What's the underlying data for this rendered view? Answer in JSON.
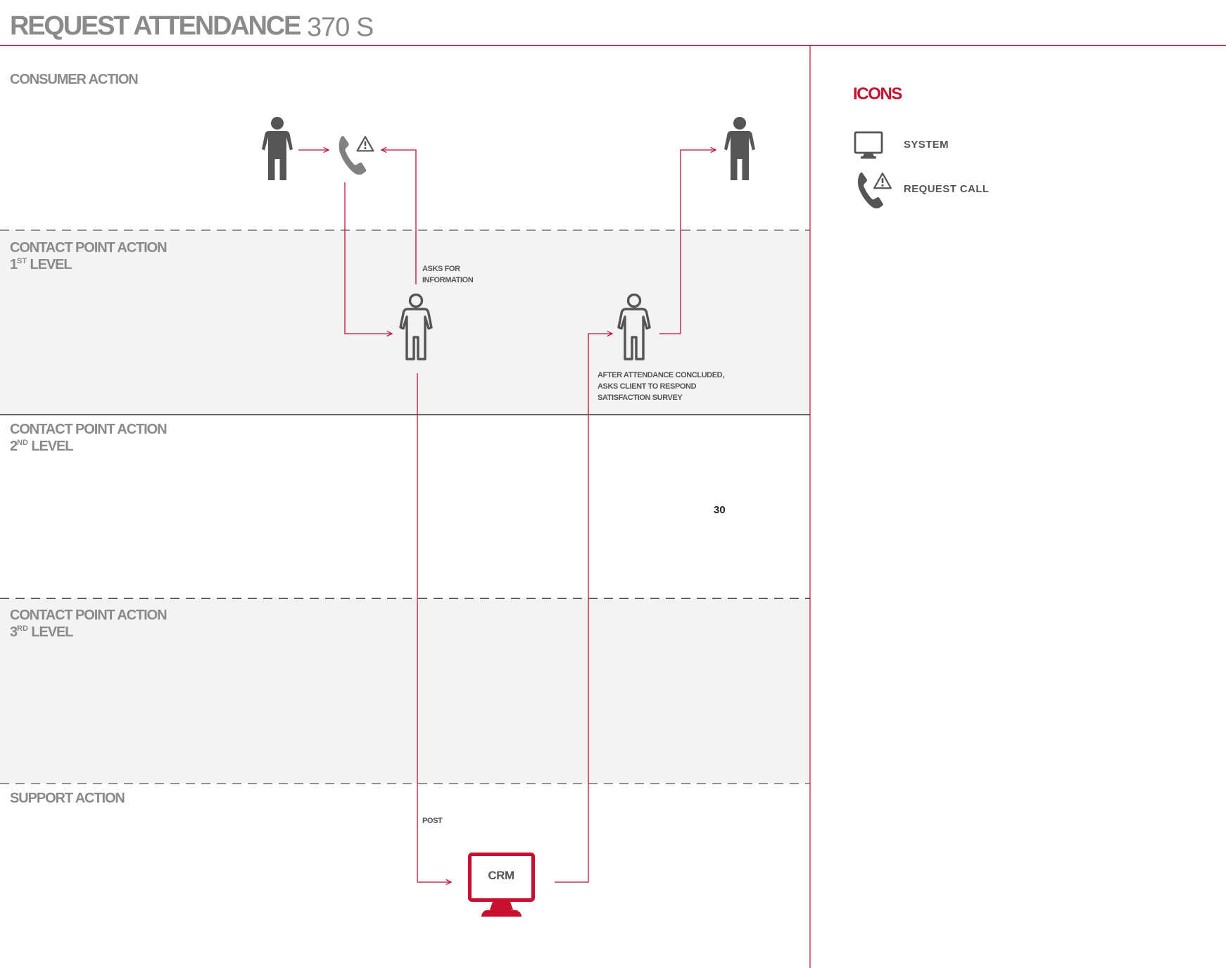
{
  "header": {
    "title": "REQUEST ATTENDANCE",
    "code": "370 S"
  },
  "lanes": [
    {
      "name": "consumer",
      "label": "CONSUMER ACTION",
      "level_num": "",
      "level_sup": "",
      "level_word": ""
    },
    {
      "name": "first-level",
      "label": "CONTACT POINT ACTION",
      "level_num": "1",
      "level_sup": "ST",
      "level_word": " LEVEL"
    },
    {
      "name": "second-level",
      "label": "CONTACT POINT ACTION",
      "level_num": "2",
      "level_sup": "ND",
      "level_word": " LEVEL"
    },
    {
      "name": "third-level",
      "label": "CONTACT POINT ACTION",
      "level_num": "3",
      "level_sup": "RD",
      "level_word": " LEVEL"
    },
    {
      "name": "support",
      "label": "SUPPORT ACTION",
      "level_num": "",
      "level_sup": "",
      "level_word": ""
    }
  ],
  "notes": {
    "asks_info": [
      "ASKS FOR",
      "INFORMATION"
    ],
    "survey": [
      "AFTER ATTENDANCE CONCLUDED,",
      "ASKS CLIENT TO RESPOND",
      "SATISFACTION SURVEY"
    ],
    "post": "POST"
  },
  "crm": {
    "label": "CRM"
  },
  "page_number": "30",
  "legend": {
    "title": "ICONS",
    "items": [
      {
        "icon": "monitor-icon",
        "label": "SYSTEM"
      },
      {
        "icon": "phone-warning-icon",
        "label": "REQUEST CALL"
      }
    ]
  },
  "colors": {
    "accent": "#c8102e",
    "icon_gray": "#555555",
    "label_gray": "#8a8a8a",
    "lane_shade": "#f3f3f3"
  }
}
